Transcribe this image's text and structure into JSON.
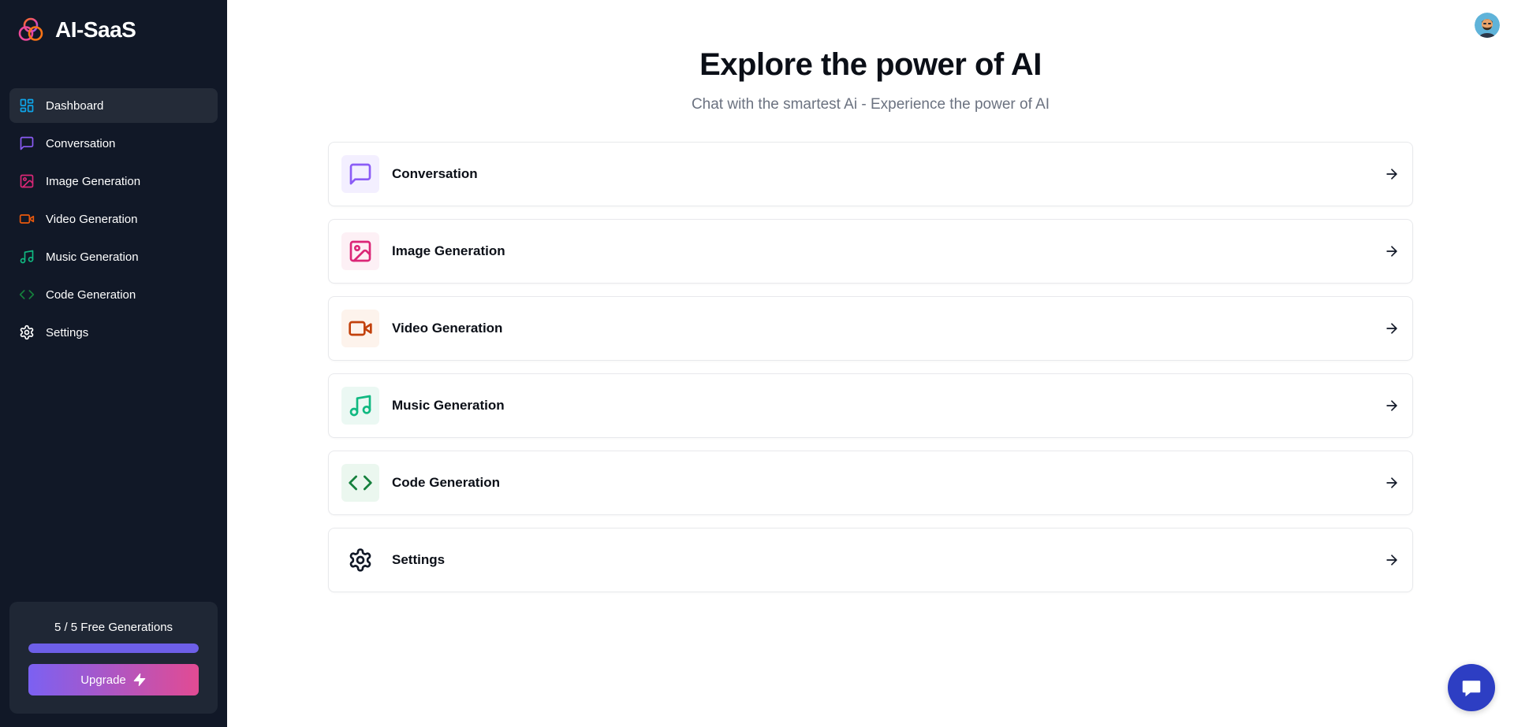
{
  "app": {
    "name": "AI-SaaS"
  },
  "sidebar": {
    "items": [
      {
        "label": "Dashboard",
        "icon": "layout-dashboard-icon",
        "color": "#0ea5e9",
        "active": true
      },
      {
        "label": "Conversation",
        "icon": "message-square-icon",
        "color": "#8b5cf6"
      },
      {
        "label": "Image Generation",
        "icon": "image-icon",
        "color": "#db2777"
      },
      {
        "label": "Video Generation",
        "icon": "video-icon",
        "color": "#ea580c"
      },
      {
        "label": "Music Generation",
        "icon": "music-icon",
        "color": "#10b981"
      },
      {
        "label": "Code Generation",
        "icon": "code-icon",
        "color": "#15803d"
      },
      {
        "label": "Settings",
        "icon": "settings-icon",
        "color": "#ffffff"
      }
    ],
    "credits": {
      "text": "5 / 5 Free Generations",
      "progress": 1.0,
      "upgrade_label": "Upgrade"
    }
  },
  "main": {
    "title": "Explore the power of AI",
    "subtitle": "Chat with the smartest Ai - Experience the power of AI",
    "cards": [
      {
        "label": "Conversation",
        "icon": "message-square-icon",
        "color": "#8b5cf6",
        "bg": "#f3efff"
      },
      {
        "label": "Image Generation",
        "icon": "image-icon",
        "color": "#db2777",
        "bg": "#fdf0f5"
      },
      {
        "label": "Video Generation",
        "icon": "video-icon",
        "color": "#c2410c",
        "bg": "#fdf3ec"
      },
      {
        "label": "Music Generation",
        "icon": "music-icon",
        "color": "#10b981",
        "bg": "#ebf8f3"
      },
      {
        "label": "Code Generation",
        "icon": "code-icon",
        "color": "#15803d",
        "bg": "#ebf7ef"
      },
      {
        "label": "Settings",
        "icon": "settings-icon",
        "color": "#111827",
        "bg": "#ffffff"
      }
    ]
  },
  "colors": {
    "sidebar_bg": "#111827",
    "progress": "#6d5fe8",
    "upgrade_gradient_start": "#7b61f2",
    "upgrade_gradient_end": "#e24b93",
    "chat_widget": "#2d3ec3"
  }
}
